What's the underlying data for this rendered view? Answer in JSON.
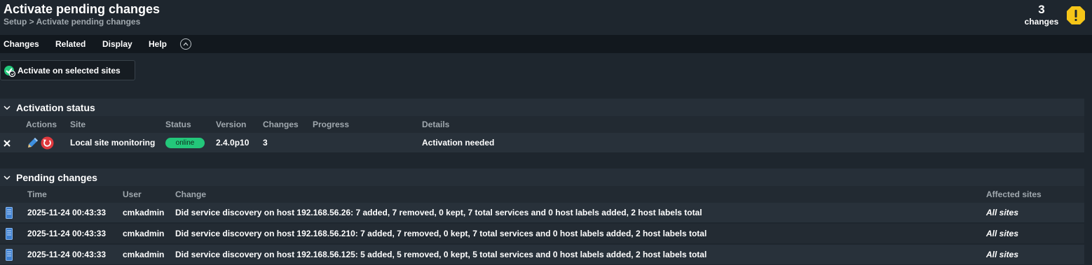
{
  "header": {
    "title": "Activate pending changes",
    "breadcrumb": "Setup > Activate pending changes",
    "changes_count": "3",
    "changes_label": "changes"
  },
  "menu": {
    "items": [
      "Changes",
      "Related",
      "Display",
      "Help"
    ]
  },
  "activate_button": {
    "label": "Activate on selected sites"
  },
  "activation_status": {
    "title": "Activation status",
    "columns": [
      "Actions",
      "Site",
      "Status",
      "Version",
      "Changes",
      "Progress",
      "Details"
    ],
    "rows": [
      {
        "site": "Local site monitoring",
        "status": "online",
        "version": "2.4.0p10",
        "changes": "3",
        "progress": "",
        "details": "Activation needed"
      }
    ]
  },
  "pending_changes": {
    "title": "Pending changes",
    "columns": [
      "Time",
      "User",
      "Change",
      "Affected sites"
    ],
    "rows": [
      {
        "time": "2025-11-24 00:43:33",
        "user": "cmkadmin",
        "change": "Did service discovery on host 192.168.56.26: 7 added, 7 removed, 0 kept, 7 total services and 0 host labels added, 2 host labels total",
        "affected": "All sites"
      },
      {
        "time": "2025-11-24 00:43:33",
        "user": "cmkadmin",
        "change": "Did service discovery on host 192.168.56.210: 7 added, 7 removed, 0 kept, 7 total services and 0 host labels added, 2 host labels total",
        "affected": "All sites"
      },
      {
        "time": "2025-11-24 00:43:33",
        "user": "cmkadmin",
        "change": "Did service discovery on host 192.168.56.125: 5 added, 5 removed, 0 kept, 5 total services and 0 host labels added, 2 host labels total",
        "affected": "All sites"
      }
    ]
  },
  "colors": {
    "background": "#1e262e",
    "menu_bar": "#12181e",
    "online_badge": "#23c77a",
    "warning": "#f5c518",
    "restart": "#e0393e"
  },
  "icons": {
    "warning": "warning-icon",
    "activate": "activate-check-icon",
    "remove": "close-icon",
    "edit": "pencil-icon",
    "restart": "restart-icon",
    "host": "host-server-icon",
    "section_toggle": "chevron-down-icon",
    "menu_toggle": "chevron-up-icon"
  }
}
